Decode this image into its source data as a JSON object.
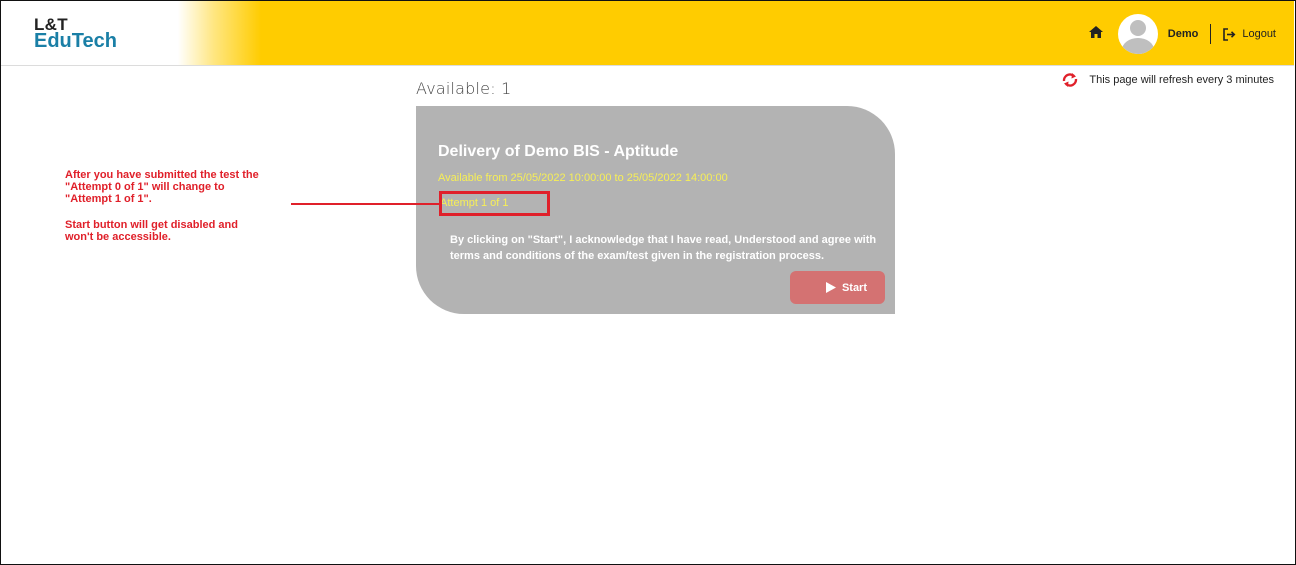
{
  "header": {
    "logo_line1": "L&T",
    "logo_line2": "EduTech",
    "user_name": "Demo",
    "logout_label": "Logout"
  },
  "refresh_notice": "This page will refresh every 3 minutes",
  "available_label": "Available: 1",
  "card": {
    "title": "Delivery of Demo BIS - Aptitude",
    "availability": "Available from 25/05/2022 10:00:00 to 25/05/2022 14:00:00",
    "attempt": "Attempt 1 of 1",
    "terms": "By clicking on \"Start\", I acknowledge that I have read, Understood and agree with terms and conditions of the exam/test given in the registration process.",
    "start_label": "Start"
  },
  "annotation": {
    "line1": "After you have submitted the test the",
    "line2": "\"Attempt 0 of 1\" will change to",
    "line3": "\"Attempt 1 of 1\".",
    "line4": "Start button will get disabled and",
    "line5": "won't be accessible."
  },
  "colors": {
    "header_bg": "#ffcc00",
    "card_bg": "#b3b3b3",
    "accent_yellow": "#f7ef56",
    "start_button": "#d47272",
    "annotation_red": "#e0202a",
    "logo_blue": "#1a7fa6"
  },
  "icons": {
    "home": "home-icon",
    "avatar": "user-avatar-icon",
    "logout": "logout-icon",
    "refresh": "refresh-icon",
    "play": "play-icon"
  }
}
